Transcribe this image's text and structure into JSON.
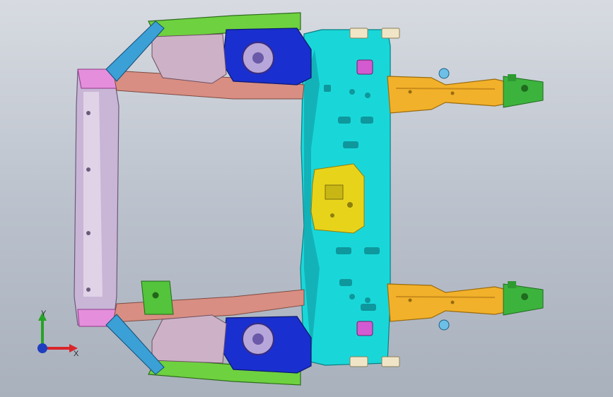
{
  "viewport": {
    "background_top": "#d7dbe1",
    "background_bottom": "#a9b1bd"
  },
  "triad": {
    "y_label": "Y",
    "x_label": "X",
    "y_color": "#27a327",
    "x_color": "#d9262b",
    "z_color": "#1f3fbf"
  },
  "model": {
    "colors": {
      "cyan": "#19d7d9",
      "blue": "#1a2fd0",
      "green": "#6ed13f",
      "orange": "#f2b12a",
      "salmon": "#d88e82",
      "pink": "#e58fdc",
      "magenta": "#d45ad1",
      "violet": "#c9b5d6",
      "yellow": "#e8d31b",
      "light": "#f0e6c7"
    }
  }
}
